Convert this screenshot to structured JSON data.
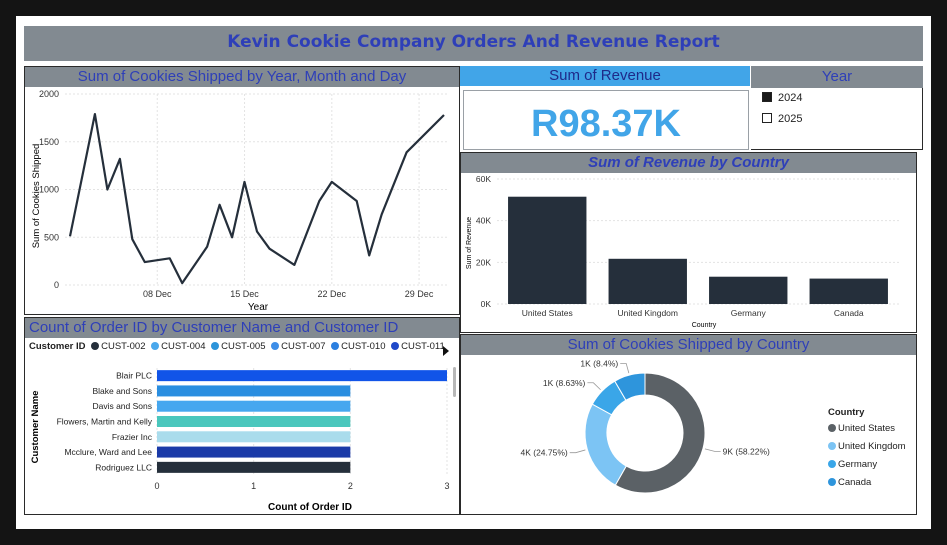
{
  "report_title": "Kevin Cookie Company Orders And Revenue Report",
  "colors": {
    "banner": "#828a91",
    "title_text": "#2e3fb8",
    "kpi": "#41a5e8",
    "dark_bar": "#252f3b"
  },
  "line_panel": {
    "title": "Sum of Cookies Shipped by Year, Month and Day",
    "chart_data": {
      "type": "line",
      "xlabel": "Year",
      "ylabel": "Sum of Cookies Shipped",
      "ylim": [
        0,
        2000
      ],
      "yticks": [
        "0",
        "500",
        "1000",
        "1500",
        "2000"
      ],
      "xticks": [
        {
          "day": 8,
          "label": "08 Dec"
        },
        {
          "day": 15,
          "label": "15 Dec"
        },
        {
          "day": 22,
          "label": "22 Dec"
        },
        {
          "day": 29,
          "label": "29 Dec"
        }
      ],
      "x": [
        1,
        2,
        3,
        4,
        5,
        6,
        7,
        9,
        10,
        12,
        13,
        14,
        15,
        16,
        17,
        19,
        21,
        22,
        24,
        25,
        26,
        28,
        31
      ],
      "values": [
        510,
        1150,
        1790,
        1000,
        1320,
        480,
        240,
        280,
        20,
        400,
        840,
        500,
        1080,
        560,
        380,
        210,
        880,
        1080,
        880,
        310,
        740,
        1390,
        1780
      ]
    }
  },
  "kpi": {
    "title": "Sum of Revenue",
    "value": "R98.37K"
  },
  "year_slicer": {
    "title": "Year",
    "items": [
      {
        "label": "2024",
        "checked": true
      },
      {
        "label": "2025",
        "checked": false
      }
    ]
  },
  "country_bar_panel": {
    "title": "Sum of Revenue by Country",
    "chart_data": {
      "type": "bar",
      "categories": [
        "United States",
        "United Kingdom",
        "Germany",
        "Canada"
      ],
      "values": [
        51500,
        21700,
        13100,
        12200
      ],
      "ylim": [
        0,
        60000
      ],
      "yticks": [
        "0K",
        "20K",
        "40K",
        "60K"
      ],
      "xlabel": "Country",
      "ylabel": "Sum of Revenue"
    }
  },
  "customer_panel": {
    "title": "Count of Order ID by Customer Name and Customer ID",
    "legend_title": "Customer ID",
    "legend": [
      {
        "label": "CUST-002",
        "color": "#252f3b"
      },
      {
        "label": "CUST-004",
        "color": "#4aa8ec"
      },
      {
        "label": "CUST-005",
        "color": "#2c94da"
      },
      {
        "label": "CUST-007",
        "color": "#3d8ee8"
      },
      {
        "label": "CUST-010",
        "color": "#2b7fe0"
      },
      {
        "label": "CUST-011",
        "color": "#1f49c9"
      }
    ],
    "chart_data": {
      "type": "bar",
      "orientation": "horizontal",
      "categories": [
        "Blair PLC",
        "Blake and Sons",
        "Davis and Sons",
        "Flowers, Martin and Kelly",
        "Frazier Inc",
        "Mcclure, Ward and Lee",
        "Rodriguez LLC"
      ],
      "values": [
        3,
        2,
        2,
        2,
        2,
        2,
        2
      ],
      "colors": [
        "#1154e8",
        "#2a8ee0",
        "#46a7ef",
        "#4ac7bd",
        "#aadcec",
        "#1a3aa8",
        "#252f3b"
      ],
      "xlim": [
        0,
        3
      ],
      "xticks": [
        "0",
        "1",
        "2",
        "3"
      ],
      "xlabel": "Count of Order ID",
      "ylabel": "Customer Name"
    }
  },
  "donut_panel": {
    "title": "Sum of Cookies Shipped by Country",
    "legend_title": "Country",
    "chart_data": {
      "type": "pie",
      "categories": [
        "United States",
        "United Kingdom",
        "Germany",
        "Canada"
      ],
      "values": [
        58.22,
        24.75,
        8.63,
        8.4
      ],
      "labels": [
        "9K (58.22%)",
        "4K (24.75%)",
        "1K (8.63%)",
        "1K (8.4%)"
      ],
      "colors": [
        "#5b6166",
        "#7cc4f4",
        "#3aa6e8",
        "#2e95dc"
      ]
    }
  }
}
